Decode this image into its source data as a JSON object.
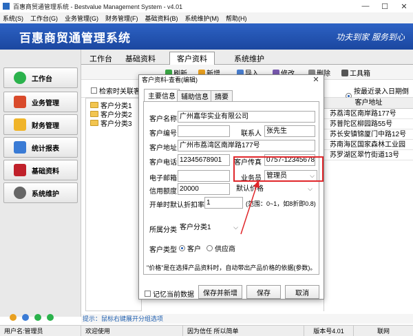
{
  "window": {
    "title": "百惠商贸通管理系统 - Bestvalue Management System - v4.01",
    "minimize": "—",
    "maximize": "☐",
    "close": "✕"
  },
  "menu": [
    "系统(S)",
    "工作台(G)",
    "业务管理(G)",
    "财务管理(F)",
    "基础资料(B)",
    "系统维护(M)",
    "帮助(H)"
  ],
  "banner": {
    "name": "百惠商贸通管理系统",
    "slogan": "功夫到家  服务到心"
  },
  "sidebar": {
    "items": [
      {
        "label": "工作台",
        "icon": "checkmark-icon",
        "color": "#2bb24c"
      },
      {
        "label": "业务管理",
        "icon": "truck-icon",
        "color": "#d94a2b"
      },
      {
        "label": "财务管理",
        "icon": "folder-icon",
        "color": "#f0b429"
      },
      {
        "label": "统计报表",
        "icon": "chart-icon",
        "color": "#3a7bd5"
      },
      {
        "label": "基础资料",
        "icon": "book-icon",
        "color": "#c0202a"
      },
      {
        "label": "系统维护",
        "icon": "gear-icon",
        "color": "#666666"
      }
    ]
  },
  "tabs": [
    "工作台",
    "基础资料",
    "客户资料",
    "系统维护"
  ],
  "toolbar": {
    "refresh": "刷新",
    "new": "新增",
    "import": "导入",
    "edit": "修改",
    "delete": "删除",
    "tools": "工具箱"
  },
  "search": {
    "checkbox_label": "检索时关联客",
    "sort_label": "按最近录入日期倒序"
  },
  "tree": [
    "客户分类1",
    "客户分类2",
    "客户分类3"
  ],
  "grid": {
    "header": "客户地址",
    "rows": [
      "苏荔湾区南岸路177号",
      "苏普陀区柳园路55号",
      "苏长安镇锦厦门中路12号",
      "苏南海区国家森林工业园",
      "苏罗湖区翠竹街道13号"
    ]
  },
  "hint": "提示：鼠标右键展开分组选项",
  "dialog": {
    "title": "客户资料-查看(编辑)",
    "close": "✕",
    "tabs": [
      "主要信息",
      "辅助信息",
      "摘要"
    ],
    "fields": {
      "name_label": "客户名称",
      "name_value": "广州嘉华实业有限公司",
      "code_label": "客户编号",
      "code_value": "",
      "contact_label": "联系人",
      "contact_value": "张先生",
      "address_label": "客户地址",
      "address_value": "广州市荔湾区南岸路177号",
      "phone_label": "客户电话",
      "phone_value": "12345678901",
      "fax_label": "客户传真",
      "fax_value": "0757-12345678",
      "email_label": "电子邮箱",
      "email_value": "",
      "salesman_label": "业务员",
      "salesman_value": "管理员",
      "credit_label": "信用额度",
      "credit_value": "20000",
      "price_value": "默认价格",
      "discount_label": "开单时默认折扣率",
      "discount_value": "1",
      "discount_note": "(范围：0~1，如8折即0.8)",
      "category_label": "所属分类",
      "category_value": "客户分类1",
      "type_label": "客户类型",
      "type_customer": "客户",
      "type_supplier": "供应商"
    },
    "note": "\"价格\"是在选择产品资料时，自动带出产品价格的依据(参数)。",
    "remember_label": "记忆当前数据",
    "save_new": "保存并新增",
    "save": "保存",
    "cancel": "取消"
  },
  "status": {
    "user": "用户名:管理员",
    "welcome": "欢迎使用",
    "motto": "因为信任  所以简单",
    "version": "版本号4.01",
    "status": "联网"
  },
  "colors": {
    "banner": "#1b47a0",
    "highlight": "#e0262a",
    "hint": "#2060b0"
  }
}
